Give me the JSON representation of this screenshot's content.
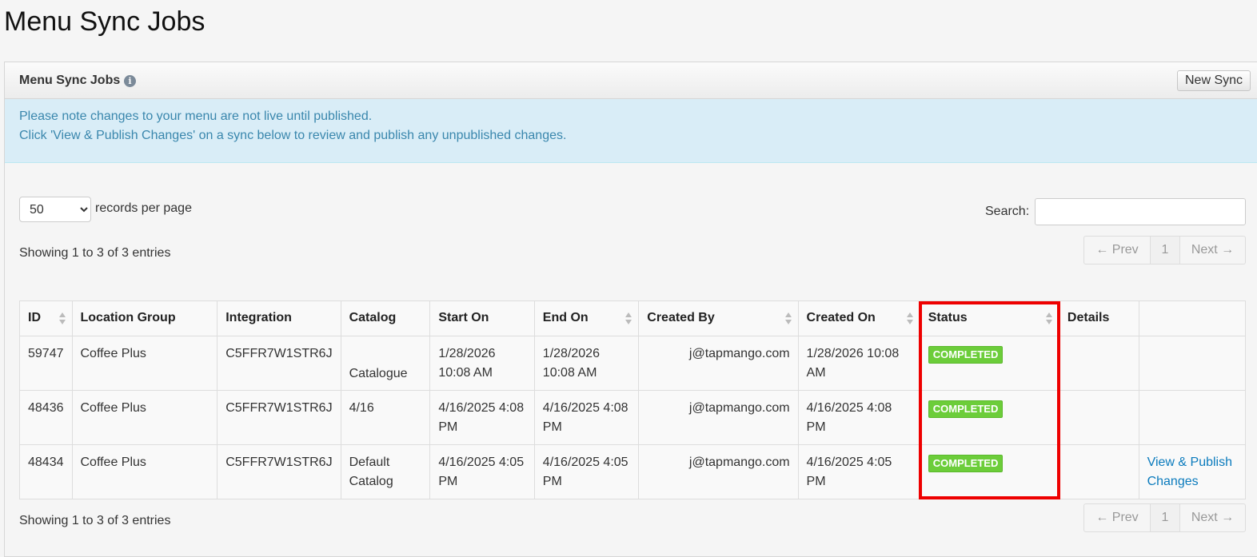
{
  "page": {
    "title": "Menu Sync Jobs"
  },
  "widget": {
    "title": "Menu Sync Jobs",
    "new_sync_label": "New Sync",
    "alert_line1": "Please note changes to your menu are not live until published.",
    "alert_line2": "Click 'View & Publish Changes' on a sync below to review and publish any unpublished changes."
  },
  "controls": {
    "per_page_value": "50",
    "per_page_label": "records per page",
    "search_label": "Search:",
    "search_value": "",
    "showing_top": "Showing 1 to 3 of 3 entries",
    "showing_bottom": "Showing 1 to 3 of 3 entries"
  },
  "pager": {
    "prev": "← Prev",
    "page": "1",
    "next": "Next →"
  },
  "table": {
    "headers": [
      "ID",
      "Location Group",
      "Integration",
      "Catalog",
      "Start On",
      "End On",
      "Created By",
      "Created On",
      "Status",
      "Details",
      ""
    ],
    "rows": [
      {
        "id": "59747",
        "location_group": "Coffee Plus",
        "integration": "C5FFR7W1STR6J",
        "catalog": "Catalogue",
        "start_on": "1/28/2026 10:08 AM",
        "end_on": "1/28/2026 10:08 AM",
        "created_by": "j@tapmango.com",
        "created_on": "1/28/2026 10:08 AM",
        "status": "COMPLETED",
        "details": "",
        "action": ""
      },
      {
        "id": "48436",
        "location_group": "Coffee Plus",
        "integration": "C5FFR7W1STR6J",
        "catalog": "4/16",
        "start_on": "4/16/2025 4:08 PM",
        "end_on": "4/16/2025 4:08 PM",
        "created_by": "j@tapmango.com",
        "created_on": "4/16/2025 4:08 PM",
        "status": "COMPLETED",
        "details": "",
        "action": ""
      },
      {
        "id": "48434",
        "location_group": "Coffee Plus",
        "integration": "C5FFR7W1STR6J",
        "catalog": "Default Catalog",
        "start_on": "4/16/2025 4:05 PM",
        "end_on": "4/16/2025 4:05 PM",
        "created_by": "j@tapmango.com",
        "created_on": "4/16/2025 4:05 PM",
        "status": "COMPLETED",
        "details": "",
        "action": "View & Publish Changes"
      }
    ]
  },
  "colors": {
    "status_completed": "#6ccd3a",
    "alert_bg": "#d9edf7",
    "highlight": "#ee0000",
    "link": "#0b7bbd"
  }
}
